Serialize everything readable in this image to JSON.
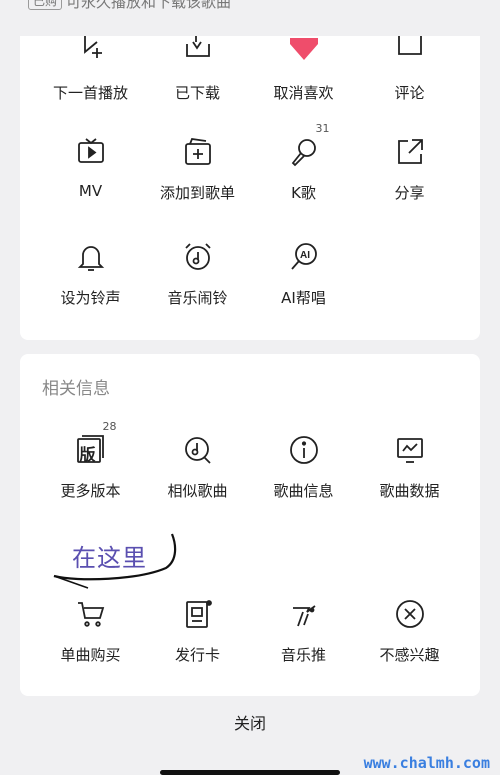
{
  "top": {
    "tag": "已购",
    "tip": "可永久播放和下载该歌曲"
  },
  "menu1": [
    {
      "icon": "play-next-icon",
      "label": "下一首播放"
    },
    {
      "icon": "downloaded-icon",
      "label": "已下载"
    },
    {
      "icon": "heart-icon",
      "label": "取消喜欢"
    },
    {
      "icon": "comment-icon",
      "label": "评论"
    },
    {
      "icon": "mv-icon",
      "label": "MV"
    },
    {
      "icon": "add-to-playlist-icon",
      "label": "添加到歌单"
    },
    {
      "icon": "karaoke-icon",
      "label": "K歌",
      "badge": "31"
    },
    {
      "icon": "share-icon",
      "label": "分享"
    },
    {
      "icon": "bell-icon",
      "label": "设为铃声"
    },
    {
      "icon": "alarm-clock-icon",
      "label": "音乐闹铃"
    },
    {
      "icon": "ai-sing-icon",
      "label": "AI帮唱"
    }
  ],
  "related": {
    "title": "相关信息",
    "items": [
      {
        "icon": "versions-icon",
        "label": "更多版本",
        "badge": "28",
        "glyph": "版"
      },
      {
        "icon": "similar-songs-icon",
        "label": "相似歌曲"
      },
      {
        "icon": "info-icon",
        "label": "歌曲信息"
      },
      {
        "icon": "song-data-icon",
        "label": "歌曲数据"
      },
      {
        "icon": "cart-icon",
        "label": "单曲购买"
      },
      {
        "icon": "release-card-icon",
        "label": "发行卡"
      },
      {
        "icon": "music-promote-icon",
        "label": "音乐推"
      },
      {
        "icon": "not-interested-icon",
        "label": "不感兴趣"
      }
    ]
  },
  "annotation": {
    "text": "在这里"
  },
  "close_label": "关闭",
  "watermark": "www.chalmh.com",
  "colors": {
    "heart": "#ef4d6b",
    "annotation": "#5a4fb0",
    "watermark": "#3a7fe0"
  }
}
